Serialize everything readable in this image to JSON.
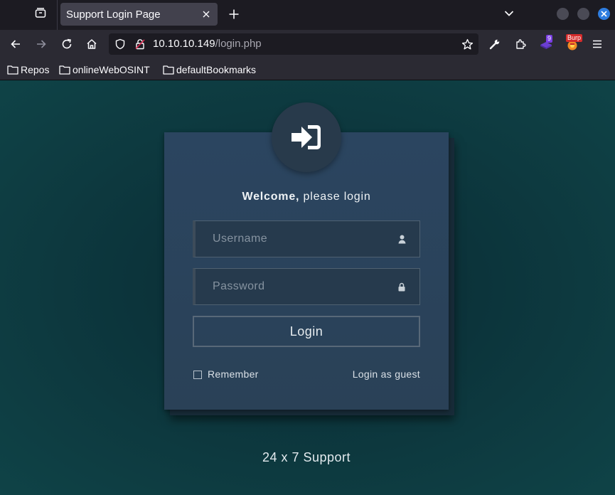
{
  "browser": {
    "tab": {
      "title": "Support Login Page"
    },
    "address": {
      "host": "10.10.10.149",
      "path": "/login.php"
    },
    "extensions": {
      "badge_count": "9",
      "burp_label": "Burp"
    },
    "bookmarks": [
      {
        "label": "Repos"
      },
      {
        "label": "onlineWebOSINT"
      },
      {
        "label": "defaultBookmarks"
      }
    ],
    "colors": {
      "chrome_dark": "#1c1b22",
      "chrome_toolbar": "#2b2a33",
      "tab_active": "#42414d",
      "close_blue": "#2e7de0"
    }
  },
  "login": {
    "welcome_bold": "Welcome,",
    "welcome_rest": " please login",
    "username_placeholder": "Username",
    "password_placeholder": "Password",
    "button_label": "Login",
    "remember_label": "Remember",
    "remember_checked": false,
    "guest_link": "Login as guest",
    "footer": "24 x 7 Support",
    "colors": {
      "card": "#2a4157",
      "page_bg": "#0c343b"
    }
  }
}
